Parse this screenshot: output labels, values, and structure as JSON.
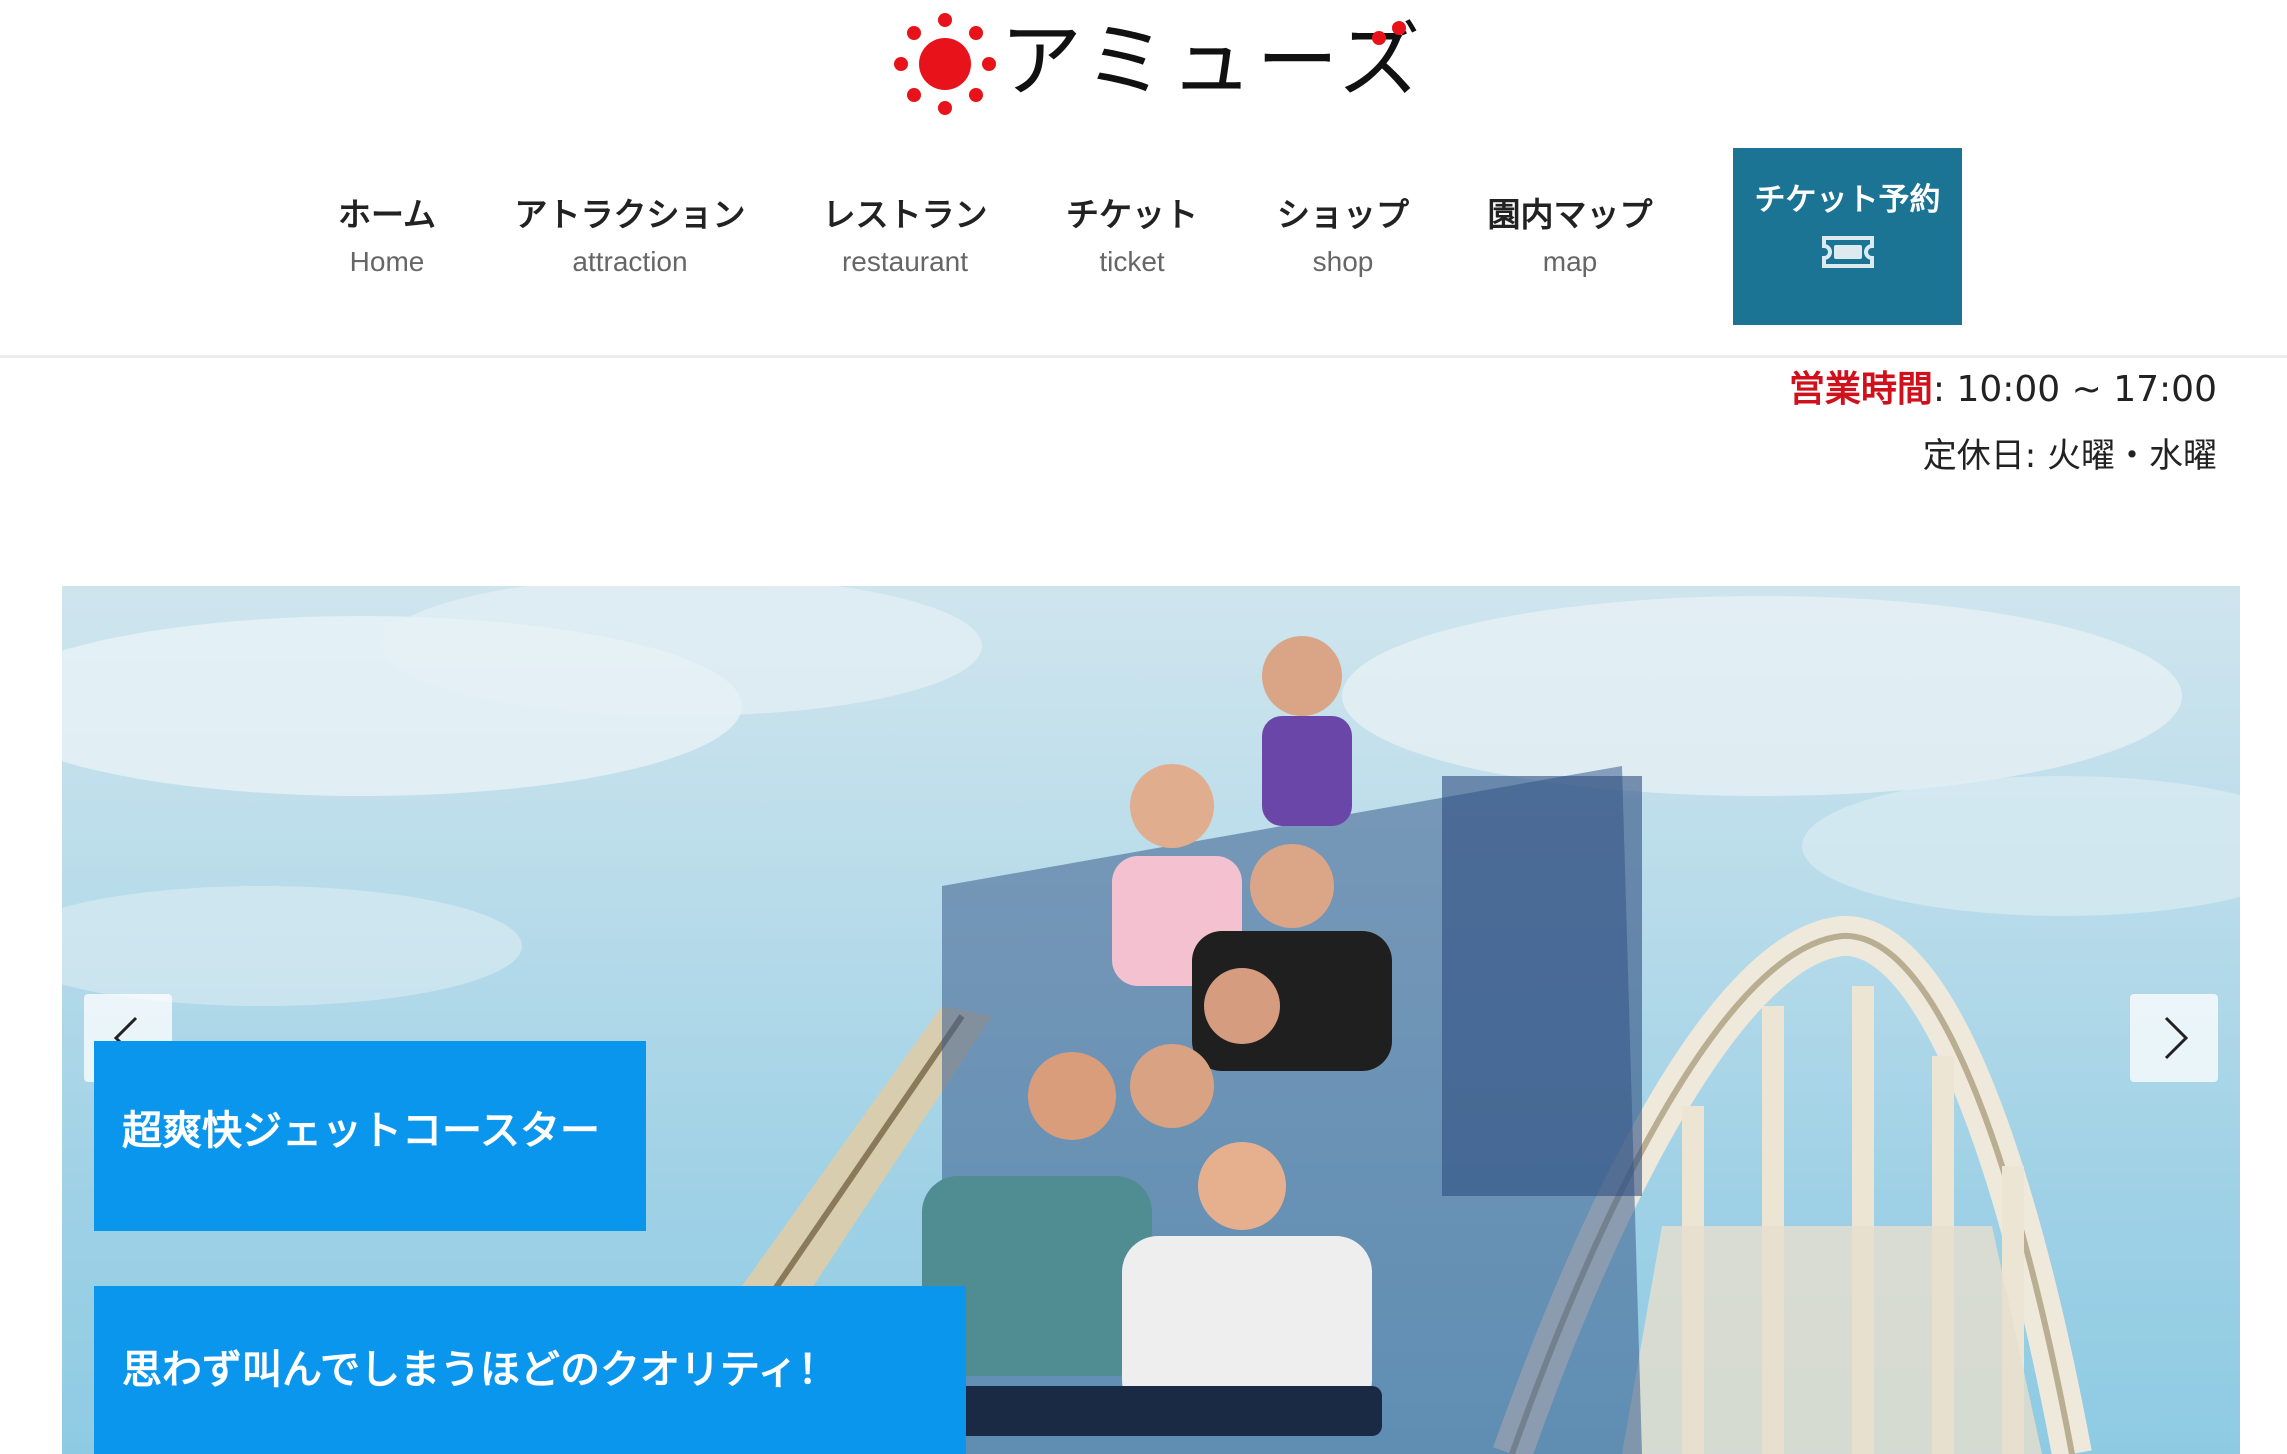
{
  "site": {
    "logo_text": "アミューズ",
    "brand_colors": {
      "sun": "#e8121a",
      "accent": "#1b7494",
      "caption_bg": "#0b96ee",
      "hours_label": "#d0111b"
    }
  },
  "nav": {
    "items": [
      {
        "jp": "ホーム",
        "en": "Home"
      },
      {
        "jp": "アトラクション",
        "en": "attraction"
      },
      {
        "jp": "レストラン",
        "en": "restaurant"
      },
      {
        "jp": "チケット",
        "en": "ticket"
      },
      {
        "jp": "ショップ",
        "en": "shop"
      },
      {
        "jp": "園内マップ",
        "en": "map"
      }
    ],
    "ticket_button": {
      "label": "チケット予約",
      "icon": "ticket-icon"
    }
  },
  "info": {
    "hours_label": "営業時間",
    "hours_value": ": 10:00 ~ 17:00",
    "holiday": "定休日: 火曜・水曜"
  },
  "hero": {
    "image_subject": "roller-coaster-riders-photo",
    "captions": [
      "超爽快ジェットコースター",
      "思わず叫んでしまうほどのクオリティ！"
    ],
    "prev_icon": "chevron-left-icon",
    "next_icon": "chevron-right-icon"
  }
}
